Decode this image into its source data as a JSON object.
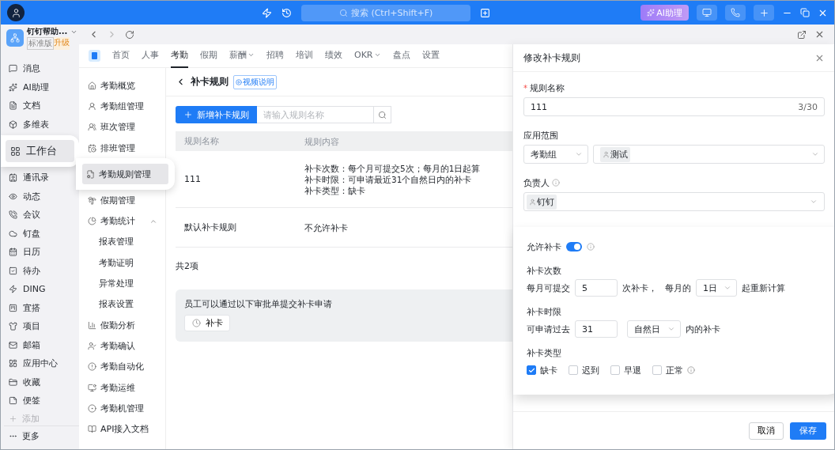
{
  "topbar": {
    "search_placeholder": "搜索 (Ctrl+Shift+F)",
    "ai_button": "AI助理"
  },
  "org": {
    "name": "钉钉帮助...",
    "edition": "标准版",
    "upgrade": "升级"
  },
  "sidebar": {
    "items": [
      {
        "label": "消息",
        "highlighted": false
      },
      {
        "label": "AI助理",
        "highlighted": false
      },
      {
        "label": "文档",
        "highlighted": false
      },
      {
        "label": "多维表",
        "highlighted": false
      },
      {
        "label": "工作台",
        "highlighted": true
      },
      {
        "label": "通讯录",
        "highlighted": false
      },
      {
        "label": "动态",
        "highlighted": false
      },
      {
        "label": "会议",
        "highlighted": false
      },
      {
        "label": "钉盘",
        "highlighted": false
      },
      {
        "label": "日历",
        "highlighted": false
      },
      {
        "label": "待办",
        "highlighted": false
      },
      {
        "label": "DING",
        "highlighted": false
      },
      {
        "label": "宜搭",
        "highlighted": false
      },
      {
        "label": "项目",
        "highlighted": false
      },
      {
        "label": "邮箱",
        "highlighted": false
      },
      {
        "label": "应用中心",
        "highlighted": false
      },
      {
        "label": "收藏",
        "highlighted": false
      },
      {
        "label": "便签",
        "highlighted": false
      }
    ],
    "add": "添加",
    "more": "更多"
  },
  "app_nav": {
    "tabs": [
      {
        "label": "首页",
        "selected": false,
        "dropdown": false
      },
      {
        "label": "人事",
        "selected": false,
        "dropdown": false
      },
      {
        "label": "考勤",
        "selected": true,
        "dropdown": false
      },
      {
        "label": "假期",
        "selected": false,
        "dropdown": false
      },
      {
        "label": "薪酬",
        "selected": false,
        "dropdown": true
      },
      {
        "label": "招聘",
        "selected": false,
        "dropdown": false
      },
      {
        "label": "培训",
        "selected": false,
        "dropdown": false
      },
      {
        "label": "绩效",
        "selected": false,
        "dropdown": false
      },
      {
        "label": "OKR",
        "selected": false,
        "dropdown": true
      },
      {
        "label": "盘点",
        "selected": false,
        "dropdown": false
      },
      {
        "label": "设置",
        "selected": false,
        "dropdown": false
      }
    ]
  },
  "module_menu": {
    "items": [
      {
        "label": "考勤概览",
        "highlighted": false
      },
      {
        "label": "考勤组管理",
        "highlighted": false
      },
      {
        "label": "班次管理",
        "highlighted": false
      },
      {
        "label": "排班管理",
        "highlighted": false
      },
      {
        "label": "考勤规则管理",
        "highlighted": true
      },
      {
        "label": "假期管理",
        "highlighted": false
      },
      {
        "label": "考勤统计",
        "highlighted": false,
        "expanded": true,
        "children": [
          {
            "label": "报表管理"
          },
          {
            "label": "考勤证明"
          },
          {
            "label": "异常处理"
          },
          {
            "label": "报表设置"
          }
        ]
      },
      {
        "label": "假勤分析",
        "highlighted": false
      },
      {
        "label": "考勤确认",
        "highlighted": false
      },
      {
        "label": "考勤自动化",
        "highlighted": false
      },
      {
        "label": "考勤运维",
        "highlighted": false
      },
      {
        "label": "考勤机管理",
        "highlighted": false
      },
      {
        "label": "API接入文档",
        "highlighted": false
      }
    ]
  },
  "page": {
    "title": "补卡规则",
    "video_badge": "视频说明",
    "add_button": "新增补卡规则",
    "search_placeholder": "请输入规则名称",
    "table": {
      "columns": [
        "规则名称",
        "规则内容"
      ],
      "rows": [
        {
          "name": "111",
          "content": [
            "补卡次数：每个月可提交5次；每月的1日起算",
            "补卡时限：可申请最近31个自然日内的补卡",
            "补卡类型：缺卡"
          ]
        },
        {
          "name": "默认补卡规则",
          "content": [
            "不允许补卡"
          ]
        }
      ]
    },
    "total": "共2项",
    "approval": {
      "text": "员工可以通过以下审批单提交补卡申请",
      "button": "补卡"
    }
  },
  "panel": {
    "title": "修改补卡规则",
    "name_label": "规则名称",
    "required_mark": "*",
    "name_value": "111",
    "name_counter": "3/30",
    "scope_label": "应用范围",
    "scope_type": "考勤组",
    "scope_tag": "测试",
    "owner_label": "负责人",
    "owner_tag": "钉钉",
    "allow_label": "允许补卡",
    "allow_on": true,
    "count": {
      "label": "补卡次数",
      "prefix": "每月可提交",
      "value": "5",
      "mid": "次补卡，",
      "mid2": "每月的",
      "day": "1日",
      "suffix": "起重新计算"
    },
    "limit": {
      "label": "补卡时限",
      "prefix": "可申请过去",
      "value": "31",
      "unit": "自然日",
      "suffix": "内的补卡"
    },
    "types": {
      "label": "补卡类型",
      "options": [
        {
          "label": "缺卡",
          "checked": true,
          "info": false
        },
        {
          "label": "迟到",
          "checked": false,
          "info": false
        },
        {
          "label": "早退",
          "checked": false,
          "info": false
        },
        {
          "label": "正常",
          "checked": false,
          "info": true
        }
      ]
    },
    "cancel": "取消",
    "save": "保存"
  }
}
